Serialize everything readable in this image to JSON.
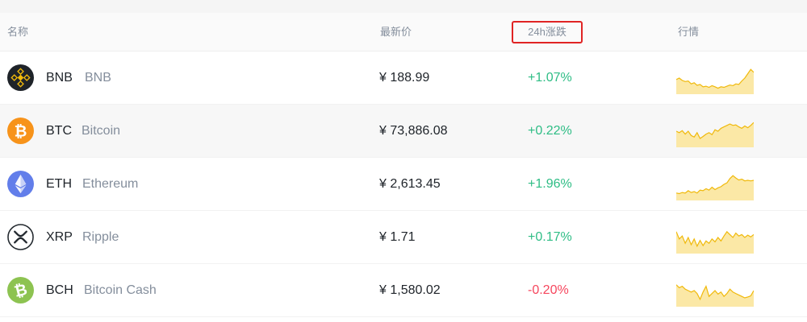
{
  "header": {
    "name": "名称",
    "price": "最新价",
    "change": "24h涨跌",
    "trend": "行情"
  },
  "colors": {
    "up": "#2ebd85",
    "down": "#f6465d",
    "spark_line": "#f0b90b",
    "spark_fill": "#fbe8a6"
  },
  "rows": [
    {
      "symbol": "BNB",
      "name": "BNB",
      "price": "¥ 188.99",
      "change": "+1.07%",
      "direction": "up",
      "icon": "bnb-icon",
      "spark": [
        0.55,
        0.5,
        0.58,
        0.62,
        0.6,
        0.7,
        0.66,
        0.75,
        0.72,
        0.8,
        0.78,
        0.82,
        0.76,
        0.8,
        0.85,
        0.8,
        0.82,
        0.78,
        0.74,
        0.76,
        0.7,
        0.72,
        0.6,
        0.5,
        0.35,
        0.2,
        0.3
      ]
    },
    {
      "symbol": "BTC",
      "name": "Bitcoin",
      "price": "¥ 73,886.08",
      "change": "+0.22%",
      "direction": "up",
      "icon": "bitcoin-icon",
      "spark": [
        0.5,
        0.55,
        0.48,
        0.6,
        0.5,
        0.65,
        0.7,
        0.55,
        0.75,
        0.68,
        0.6,
        0.55,
        0.62,
        0.45,
        0.5,
        0.4,
        0.35,
        0.3,
        0.25,
        0.3,
        0.28,
        0.35,
        0.4,
        0.32,
        0.38,
        0.3,
        0.2
      ]
    },
    {
      "symbol": "ETH",
      "name": "Ethereum",
      "price": "¥ 2,613.45",
      "change": "+1.96%",
      "direction": "up",
      "icon": "ethereum-icon",
      "spark": [
        0.8,
        0.82,
        0.78,
        0.8,
        0.72,
        0.78,
        0.75,
        0.8,
        0.7,
        0.72,
        0.65,
        0.7,
        0.6,
        0.68,
        0.62,
        0.58,
        0.5,
        0.45,
        0.3,
        0.2,
        0.28,
        0.35,
        0.32,
        0.38,
        0.36,
        0.38,
        0.36
      ]
    },
    {
      "symbol": "XRP",
      "name": "Ripple",
      "price": "¥ 1.71",
      "change": "+0.17%",
      "direction": "up",
      "icon": "ripple-icon",
      "spark": [
        0.3,
        0.55,
        0.45,
        0.7,
        0.5,
        0.75,
        0.55,
        0.8,
        0.6,
        0.78,
        0.62,
        0.7,
        0.55,
        0.65,
        0.5,
        0.62,
        0.45,
        0.3,
        0.4,
        0.5,
        0.35,
        0.45,
        0.4,
        0.5,
        0.42,
        0.48,
        0.4
      ]
    },
    {
      "symbol": "BCH",
      "name": "Bitcoin Cash",
      "price": "¥ 1,580.02",
      "change": "-0.20%",
      "direction": "down",
      "icon": "bitcoin-cash-icon",
      "spark": [
        0.3,
        0.4,
        0.35,
        0.45,
        0.5,
        0.55,
        0.5,
        0.6,
        0.8,
        0.55,
        0.35,
        0.7,
        0.6,
        0.5,
        0.62,
        0.55,
        0.7,
        0.6,
        0.45,
        0.55,
        0.6,
        0.65,
        0.7,
        0.75,
        0.72,
        0.68,
        0.5
      ]
    }
  ]
}
